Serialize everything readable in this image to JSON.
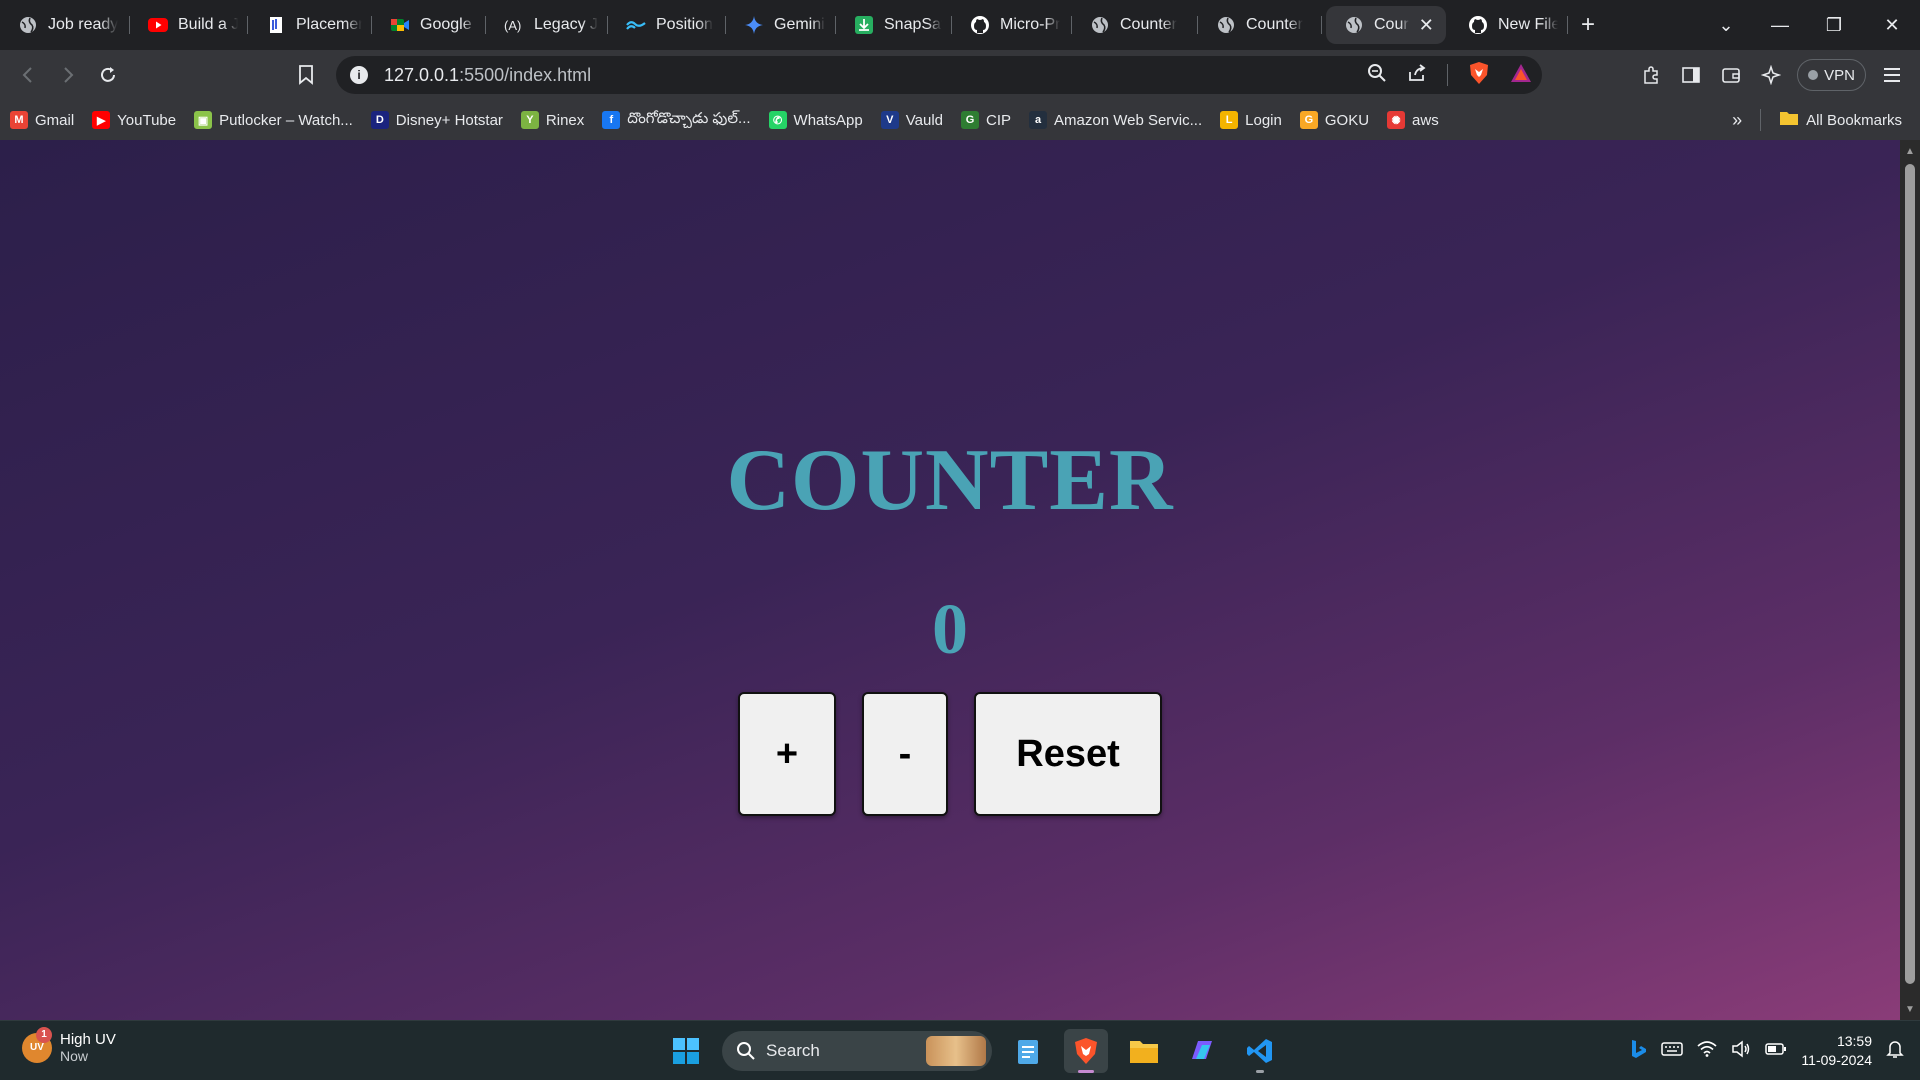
{
  "browser": {
    "tabs": [
      {
        "title": "Job ready",
        "icon": "globe-icon"
      },
      {
        "title": "Build a Ja",
        "icon": "youtube-icon"
      },
      {
        "title": "Placemen",
        "icon": "document-icon"
      },
      {
        "title": "Google M",
        "icon": "meet-icon"
      },
      {
        "title": "Legacy Ja",
        "icon": "legacy-icon"
      },
      {
        "title": "Position",
        "icon": "tailwind-icon"
      },
      {
        "title": "Gemini",
        "icon": "gemini-icon"
      },
      {
        "title": "SnapSave",
        "icon": "download-icon"
      },
      {
        "title": "Micro-Pr",
        "icon": "github-icon"
      },
      {
        "title": "Counter",
        "icon": "globe-icon"
      },
      {
        "title": "Counter",
        "icon": "globe-icon"
      },
      {
        "title": "Cour",
        "icon": "globe-icon",
        "active": true
      },
      {
        "title": "New File",
        "icon": "github-icon"
      }
    ],
    "new_tab_label": "+",
    "url": {
      "host": "127.0.0.1",
      "rest": ":5500/index.html"
    },
    "vpn_label": "VPN",
    "bookmarks": [
      {
        "label": "Gmail",
        "icon": "gmail-icon",
        "color": "#ea4335",
        "glyph": "M"
      },
      {
        "label": "YouTube",
        "icon": "youtube-icon",
        "color": "#ff0000",
        "glyph": "▶"
      },
      {
        "label": "Putlocker – Watch...",
        "icon": "putlocker-icon",
        "color": "#8bc34a",
        "glyph": "▣"
      },
      {
        "label": "Disney+ Hotstar",
        "icon": "hotstar-icon",
        "color": "#1a237e",
        "glyph": "D"
      },
      {
        "label": "Rinex",
        "icon": "rinex-icon",
        "color": "#7cb342",
        "glyph": "Y"
      },
      {
        "label": "దొంగోడొచ్చాడు ఫుల్...",
        "icon": "facebook-icon",
        "color": "#1877f2",
        "glyph": "f"
      },
      {
        "label": "WhatsApp",
        "icon": "whatsapp-icon",
        "color": "#25d366",
        "glyph": "✆"
      },
      {
        "label": "Vauld",
        "icon": "vauld-icon",
        "color": "#1e3a8a",
        "glyph": "V"
      },
      {
        "label": "CIP",
        "icon": "cip-icon",
        "color": "#2e7d32",
        "glyph": "G"
      },
      {
        "label": "Amazon Web Servic...",
        "icon": "aws-icon",
        "color": "#232f3e",
        "glyph": "a"
      },
      {
        "label": "Login",
        "icon": "login-icon",
        "color": "#f4b400",
        "glyph": "L"
      },
      {
        "label": "GOKU",
        "icon": "goku-icon",
        "color": "#f9a825",
        "glyph": "G"
      },
      {
        "label": "aws",
        "icon": "aws-ring-icon",
        "color": "#e53935",
        "glyph": "✺"
      }
    ],
    "all_bookmarks_label": "All Bookmarks"
  },
  "page": {
    "title": "COUNTER",
    "count": "0",
    "buttons": {
      "increment": "+",
      "decrement": "-",
      "reset": "Reset"
    }
  },
  "taskbar": {
    "weather": {
      "badge": "1",
      "icon_text": "UV",
      "title": "High UV",
      "subtitle": "Now"
    },
    "search_label": "Search",
    "time": "13:59",
    "date": "11-09-2024"
  }
}
